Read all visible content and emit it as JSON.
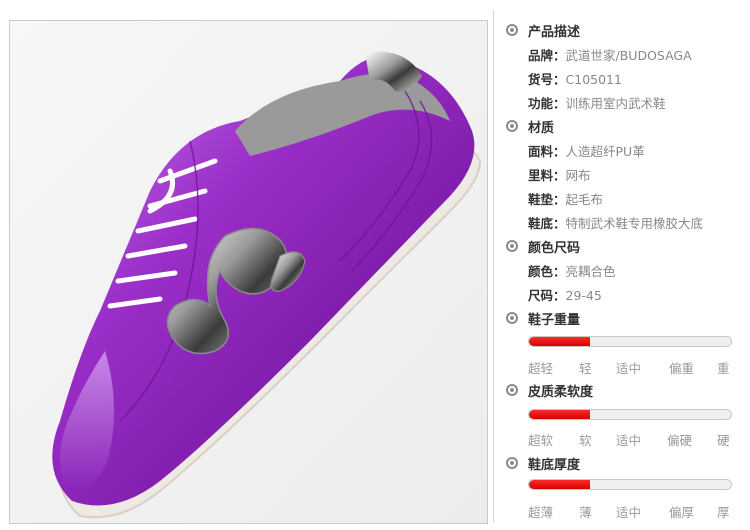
{
  "spec": {
    "sections": [
      {
        "title": "产品描述",
        "rows": [
          {
            "key": "品牌：",
            "value": "武道世家/BUDOSAGA"
          },
          {
            "key": "货号：",
            "value": "C105011"
          },
          {
            "key": "功能：",
            "value": "训练用室内武术鞋"
          }
        ]
      },
      {
        "title": "材质",
        "rows": [
          {
            "key": "面料：",
            "value": "人造超纤PU革"
          },
          {
            "key": "里料：",
            "value": "网布"
          },
          {
            "key": "鞋垫：",
            "value": "起毛布"
          },
          {
            "key": "鞋底：",
            "value": "特制武术鞋专用橡胶大底"
          }
        ]
      },
      {
        "title": "颜色尺码",
        "rows": [
          {
            "key": "颜色：",
            "value": "亮耦合色"
          },
          {
            "key": "尺码：",
            "value": "29-45"
          }
        ]
      }
    ]
  },
  "ratings": [
    {
      "title": "鞋子重量",
      "level": 0.3,
      "scale": [
        "超轻",
        "轻",
        "适中",
        "偏重",
        "重"
      ]
    },
    {
      "title": "皮质柔软度",
      "level": 0.3,
      "scale": [
        "超软",
        "软",
        "适中",
        "偏硬",
        "硬"
      ]
    },
    {
      "title": "鞋底厚度",
      "level": 0.3,
      "scale": [
        "超薄",
        "薄",
        "适中",
        "偏厚",
        "厚"
      ]
    }
  ],
  "colors": {
    "accent": "#e00000",
    "shoe": "#9b2fc9"
  }
}
